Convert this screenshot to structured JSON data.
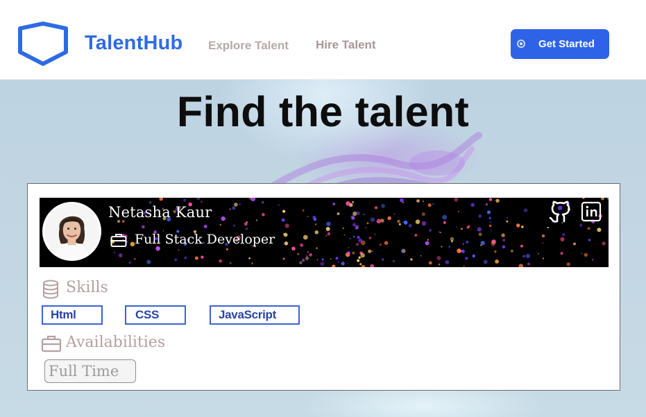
{
  "header": {
    "brand": "TalentHub",
    "logo_icon": "shield-icon",
    "nav": [
      {
        "label": "Explore Talent"
      },
      {
        "label": "Hire Talent"
      }
    ],
    "cta_label": "Get Started",
    "cta_icon": "circle-dot-icon"
  },
  "hero": {
    "title": "Find the talent"
  },
  "profile": {
    "name": "Netasha Kaur",
    "role": "Full Stack Developer",
    "role_icon": "briefcase-icon",
    "social": [
      "github-icon",
      "linkedin-icon"
    ],
    "skills_heading": "Skills",
    "skills_icon": "database-icon",
    "skills": [
      "Html",
      "CSS",
      "JavaScript"
    ],
    "availability_heading": "Availabilities",
    "availability_icon": "briefcase-icon",
    "availability": [
      "Full Time"
    ]
  },
  "colors": {
    "brand": "#2d6be4",
    "cta": "#2e63e8",
    "tag_border": "#3b63d1",
    "section_text": "#b49f9f"
  }
}
